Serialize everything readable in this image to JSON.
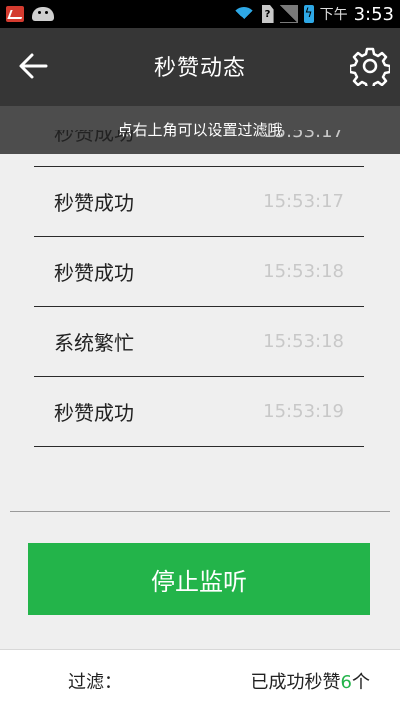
{
  "status_bar": {
    "ampm": "下午",
    "time": "3:53",
    "icons": [
      "app-icon",
      "android-icon",
      "wifi-icon",
      "sim-icon",
      "signal-icon",
      "battery-icon"
    ]
  },
  "header": {
    "title": "秒赞动态",
    "back_icon": "back-arrow-icon",
    "settings_icon": "gear-icon"
  },
  "hint": "点右上角可以设置过滤哦",
  "log": [
    {
      "status": "秒赞成功",
      "time": "15:53:17"
    },
    {
      "status": "秒赞成功",
      "time": "15:53:17"
    },
    {
      "status": "秒赞成功",
      "time": "15:53:18"
    },
    {
      "status": "系统繁忙",
      "time": "15:53:18"
    },
    {
      "status": "秒赞成功",
      "time": "15:53:19"
    }
  ],
  "actions": {
    "stop_label": "停止监听"
  },
  "footer": {
    "filter_label": "过滤：",
    "count_prefix": "已成功秒赞",
    "count_value": "6",
    "count_suffix": "个"
  },
  "colors": {
    "accent": "#23b44a",
    "titlebar": "#363636",
    "hintbar": "#4d4d4d"
  }
}
